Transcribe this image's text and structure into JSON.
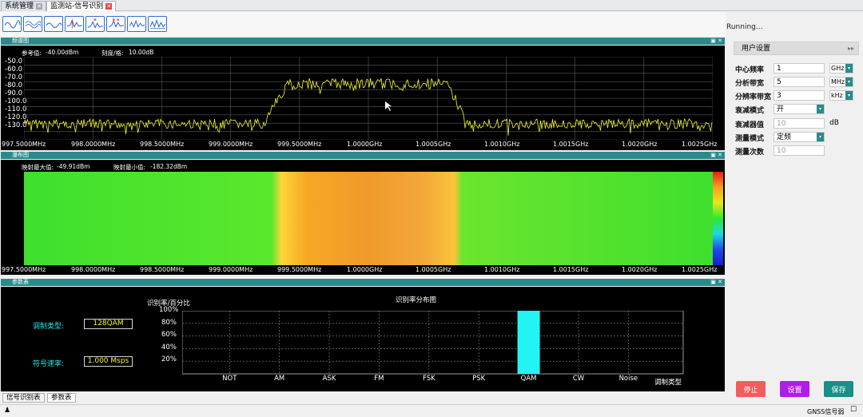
{
  "tabs": [
    {
      "label": "系统管理"
    },
    {
      "label": "监测站-信号识别"
    }
  ],
  "toolbar": {
    "icons": [
      "spectrum-icon",
      "spectrum-2-icon",
      "spectrum-3-icon",
      "peak-icon",
      "marker-icon",
      "marker-2-icon",
      "wave-icon",
      "wave-2-icon"
    ]
  },
  "status_running": "Running...",
  "spectrum_panel": {
    "title": "频谱图",
    "ref_label": "参考值:",
    "ref_value": "-40.00dBm",
    "scale_label": "刻度/格:",
    "scale_value": "10.00dB",
    "y_ticks": [
      "-50.0",
      "-60.0",
      "-70.0",
      "-80.0",
      "-90.0",
      "-100.0",
      "-110.0",
      "-120.0",
      "-130.0"
    ],
    "x_ticks": [
      "997.5000MHz",
      "998.0000MHz",
      "998.5000MHz",
      "999.0000MHz",
      "999.5000MHz",
      "1.0000GHz",
      "1.0005GHz",
      "1.0010GHz",
      "1.0015GHz",
      "1.0020GHz",
      "1.0025GHz"
    ]
  },
  "waterfall_panel": {
    "title": "瀑布图",
    "max_label": "映射最大值:",
    "max_value": "-49.91dBm",
    "min_label": "映射最小值:",
    "min_value": "-182.32dBm",
    "x_ticks": [
      "997.5000MHz",
      "998.0000MHz",
      "998.5000MHz",
      "999.0000MHz",
      "999.5000MHz",
      "1.0000GHz",
      "1.0005GHz",
      "1.0010GHz",
      "1.0015GHz",
      "1.0020GHz",
      "1.0025GHz"
    ]
  },
  "param_panel": {
    "title": "参数表",
    "mod_label": "调制类型:",
    "mod_value": "128QAM",
    "rate_label": "符号速率:",
    "rate_value": "1.000 Msps"
  },
  "chart_data": {
    "type": "bar",
    "title": "识别率分布图",
    "ylabel": "识别率/百分比",
    "xlabel": "调制类型",
    "categories": [
      "NOT",
      "AM",
      "ASK",
      "FM",
      "FSK",
      "PSK",
      "QAM",
      "CW",
      "Noise"
    ],
    "values": [
      0,
      0,
      0,
      0,
      0,
      0,
      100,
      0,
      0
    ],
    "y_ticks": [
      "100%",
      "80%",
      "60%",
      "40%",
      "20%"
    ],
    "ylim": [
      0,
      100
    ],
    "grid": true,
    "bar_color": "#22f4f4"
  },
  "user_settings": {
    "title": "用户设置",
    "center_freq": {
      "label": "中心频率",
      "value": "1",
      "unit": "GHz"
    },
    "span": {
      "label": "分析带宽",
      "value": "5",
      "unit": "MHz"
    },
    "rbw": {
      "label": "分辨率带宽",
      "value": "3",
      "unit": "kHz"
    },
    "atten_mode": {
      "label": "衰减模式",
      "value": "开"
    },
    "atten_value": {
      "label": "衰减器值",
      "placeholder": "10",
      "unit": "dB"
    },
    "meas_mode": {
      "label": "测量模式",
      "value": "定频"
    },
    "meas_count": {
      "label": "测量次数",
      "placeholder": "10"
    }
  },
  "buttons": {
    "stop": "停止",
    "set": "设置",
    "save": "保存"
  },
  "bottom_tabs": [
    {
      "label": "信号识别表"
    },
    {
      "label": "参数表"
    }
  ],
  "statusbar": {
    "gnss": "GNSS信号弱"
  }
}
